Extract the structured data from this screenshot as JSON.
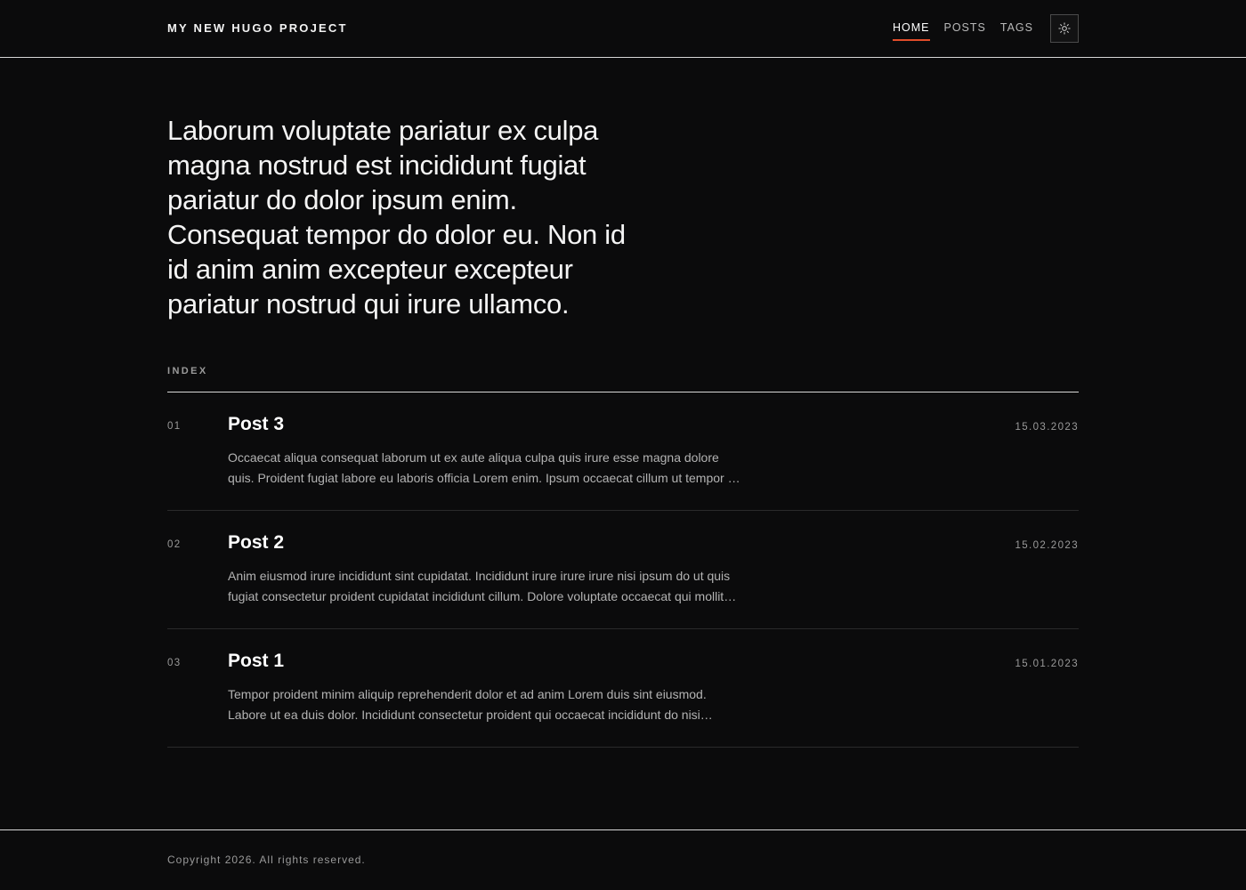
{
  "header": {
    "brand": "MY NEW HUGO PROJECT",
    "nav": [
      {
        "label": "HOME",
        "active": true
      },
      {
        "label": "POSTS",
        "active": false
      },
      {
        "label": "TAGS",
        "active": false
      }
    ],
    "theme_toggle_icon": "sun-icon"
  },
  "hero": {
    "text": "Laborum voluptate pariatur ex culpa magna nostrud est incididunt fugiat pariatur do dolor ipsum enim. Consequat tempor do dolor eu. Non id id anim anim excepteur excepteur pariatur nostrud qui irure ullamco."
  },
  "index": {
    "label": "INDEX",
    "posts": [
      {
        "num": "01",
        "title": "Post 3",
        "date": "15.03.2023",
        "excerpt": "Occaecat aliqua consequat laborum ut ex aute aliqua culpa quis irure esse magna dolore quis. Proident fugiat labore eu laboris officia Lorem enim. Ipsum occaecat cillum ut tempor …"
      },
      {
        "num": "02",
        "title": "Post 2",
        "date": "15.02.2023",
        "excerpt": "Anim eiusmod irure incididunt sint cupidatat. Incididunt irure irure irure nisi ipsum do ut quis fugiat consectetur proident cupidatat incididunt cillum. Dolore voluptate occaecat qui mollit…"
      },
      {
        "num": "03",
        "title": "Post 1",
        "date": "15.01.2023",
        "excerpt": "Tempor proident minim aliquip reprehenderit dolor et ad anim Lorem duis sint eiusmod. Labore ut ea duis dolor. Incididunt consectetur proident qui occaecat incididunt do nisi…"
      }
    ]
  },
  "footer": {
    "copyright": "Copyright 2026. All rights reserved."
  },
  "colors": {
    "background": "#0b0b0c",
    "accent": "#e14d2a",
    "text": "#f4f4f4",
    "muted": "#9a9a9a"
  }
}
